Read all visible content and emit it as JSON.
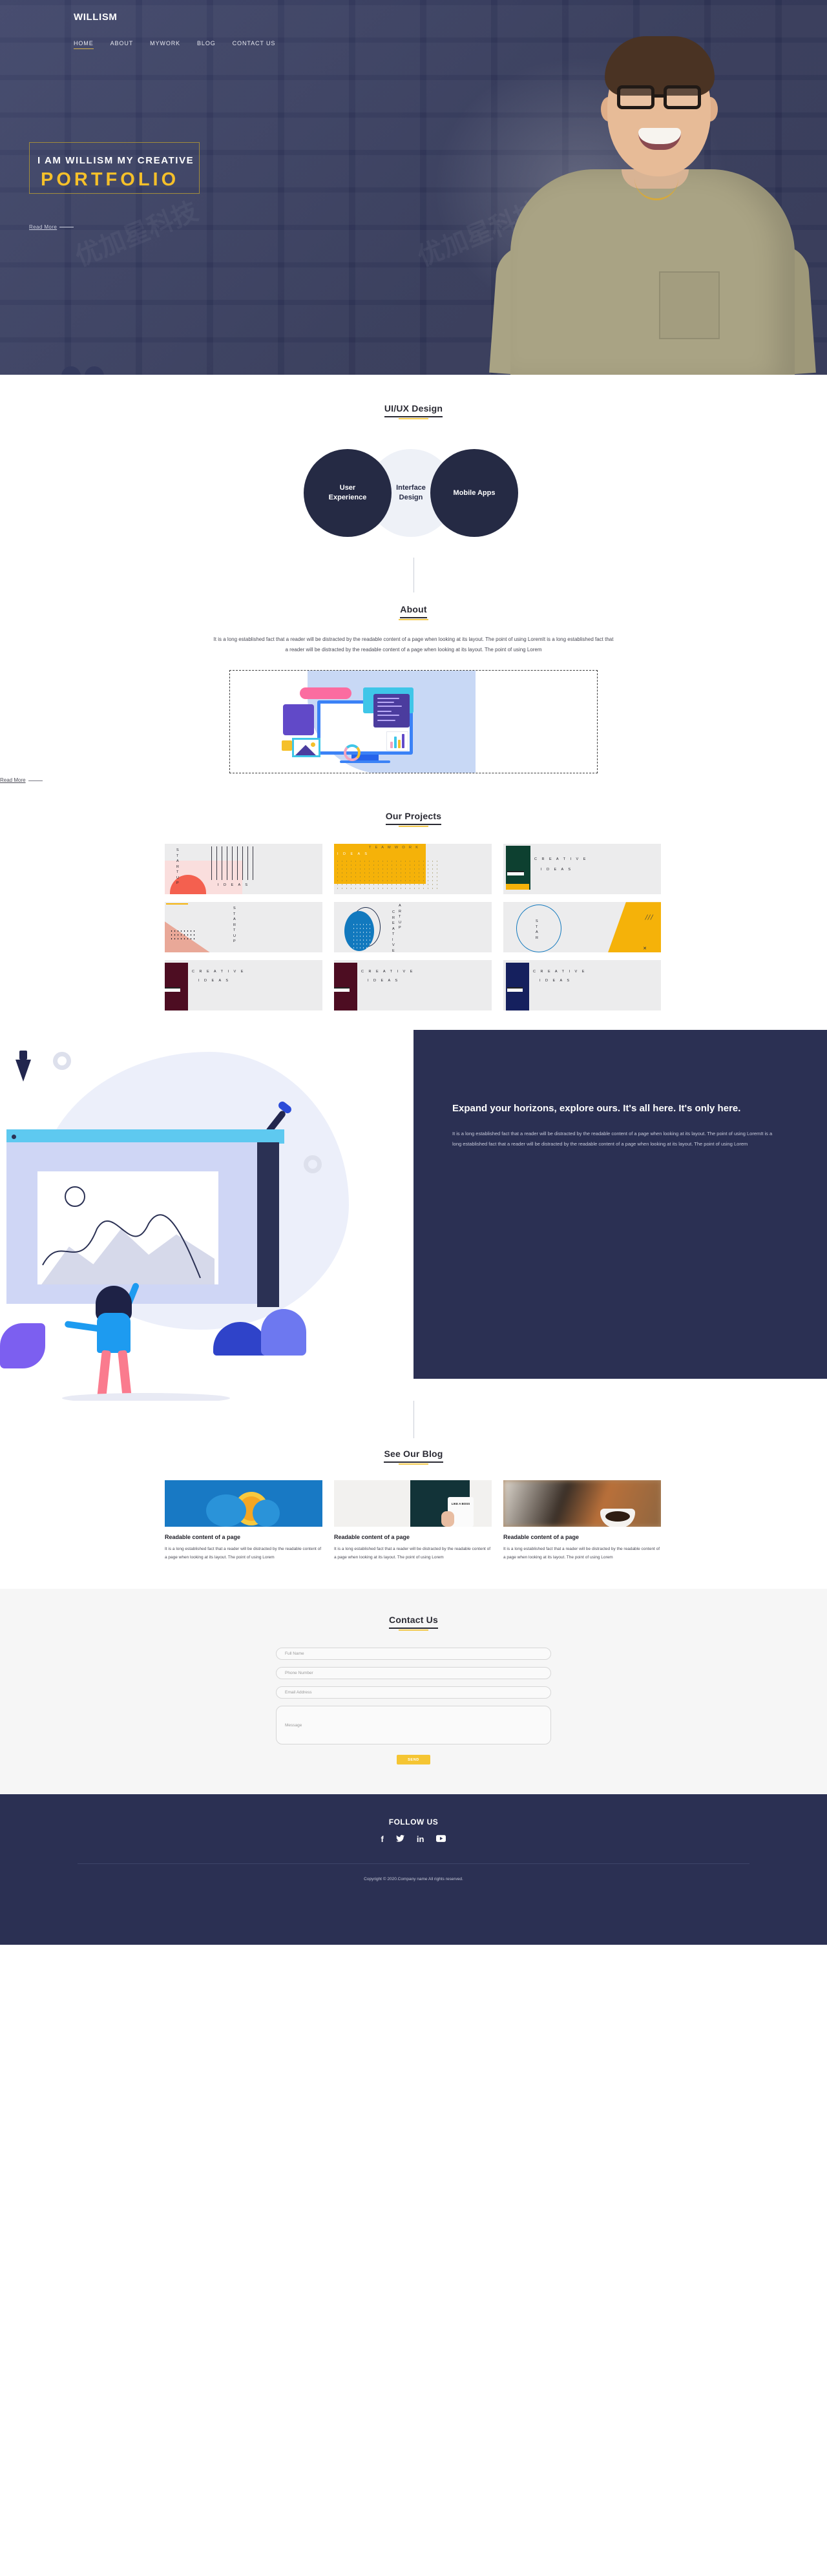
{
  "theme": {
    "navy": "#2b3053",
    "gold": "#f5c533",
    "dark_circle": "#252a44",
    "light_circle": "#eef1f7",
    "page_bg": "#ffffff",
    "contact_bg": "#f6f6f6"
  },
  "header": {
    "logo": "WILLISM",
    "nav": [
      {
        "label": "HOME",
        "active": true
      },
      {
        "label": "ABOUT",
        "active": false
      },
      {
        "label": "MYWORK",
        "active": false
      },
      {
        "label": "BLOG",
        "active": false
      },
      {
        "label": "CONTACT US",
        "active": false
      }
    ]
  },
  "hero": {
    "line1": "I AM WILLISM MY CREATIVE",
    "line2": "PORTFOLIO",
    "read_more": "Read More",
    "prev_icon": "‹",
    "next_icon": "›"
  },
  "uiux": {
    "title": "UI/UX Design",
    "circles": [
      {
        "label": "User\nExperience",
        "line1": "User",
        "line2": "Experience",
        "style": "dark"
      },
      {
        "label": "Interface Design",
        "line1": "Interface",
        "line2": "Design",
        "style": "light"
      },
      {
        "label": "Mobile Apps",
        "line1": "Mobile Apps",
        "line2": "",
        "style": "dark"
      }
    ]
  },
  "about": {
    "title": "About",
    "paragraph": "It is a long established fact that a reader will be distracted by the readable content of a page when looking at its layout. The point of using LoremIt is a long established fact that a reader will be distracted by the readable content of a page when looking at its layout. The point of using Lorem",
    "read_more": "Read More",
    "image_alt": "web-design-illustration"
  },
  "projects": {
    "title": "Our Projects",
    "cards": [
      {
        "id": "startup-ideas",
        "vertical_text": "S T A R T U P",
        "label": "I D E A S"
      },
      {
        "id": "teamwork-ideas",
        "top_text": "T E A M W O R K",
        "label": "I D E A S"
      },
      {
        "id": "creative-ideas-green",
        "label": "C R E A T I V E",
        "label2": "I D E A S"
      },
      {
        "id": "startup-pink",
        "vertical_text": "S T A R T U P",
        "label": ""
      },
      {
        "id": "creative-startup-blue",
        "vertical_text": "C R E A T I V E",
        "vertical_text2": "A R T U P"
      },
      {
        "id": "star-yellow",
        "vertical_text": "S T A R",
        "label": ""
      },
      {
        "id": "creative-ideas-maroon",
        "label": "C R E A T I V E",
        "label2": "I D E A S"
      },
      {
        "id": "creative-ideas-maroon-2",
        "label": "C R E A T I V E",
        "label2": "I D E A S"
      },
      {
        "id": "creative-ideas-navy",
        "label": "C R E A T I V E",
        "label2": "I D E A S"
      }
    ]
  },
  "expand": {
    "heading": "Expand your horizons, explore ours. It's all here. It's only here.",
    "paragraph": "It is a long established fact that a reader will be distracted by the readable content of a page when looking at its layout. The point of using LoremIt is a long established fact that a reader will be distracted by the readable content of a page when looking at its layout. The point of using Lorem",
    "illustration_alt": "designer-at-screen-illustration"
  },
  "blog": {
    "title": "See Our Blog",
    "posts": [
      {
        "image_alt": "blue-orange-photo",
        "title": "Readable content of a page",
        "body": "It is a long established fact that a reader will be distracted by the readable content of a page when looking at its layout. The point of using Lorem"
      },
      {
        "image_alt": "like-a-boss-mug-photo",
        "mug_text": "LIKE A BOSS",
        "title": "Readable content of a page",
        "body": "It is a long established fact that a reader will be distracted by the readable content of a page when looking at its layout. The point of using Lorem"
      },
      {
        "image_alt": "coffee-cup-photo",
        "title": "Readable content of a page",
        "body": "It is a long established fact that a reader will be distracted by the readable content of a page when looking at its layout. The point of using Lorem"
      }
    ]
  },
  "contact": {
    "title": "Contact Us",
    "fields": {
      "full_name_placeholder": "Full Name",
      "phone_placeholder": "Phone Number",
      "email_placeholder": "Email Address",
      "message_placeholder": "Message"
    },
    "send_label": "SEND"
  },
  "footer": {
    "follow_us": "FOLLOW US",
    "socials": [
      {
        "name": "facebook-icon",
        "glyph": "f"
      },
      {
        "name": "twitter-icon",
        "glyph": "ᴠ"
      },
      {
        "name": "linkedin-icon",
        "glyph": "in"
      },
      {
        "name": "youtube-icon",
        "glyph": "▶"
      }
    ],
    "copyright": "Copyright © 2020.Company name All rights reserved."
  }
}
